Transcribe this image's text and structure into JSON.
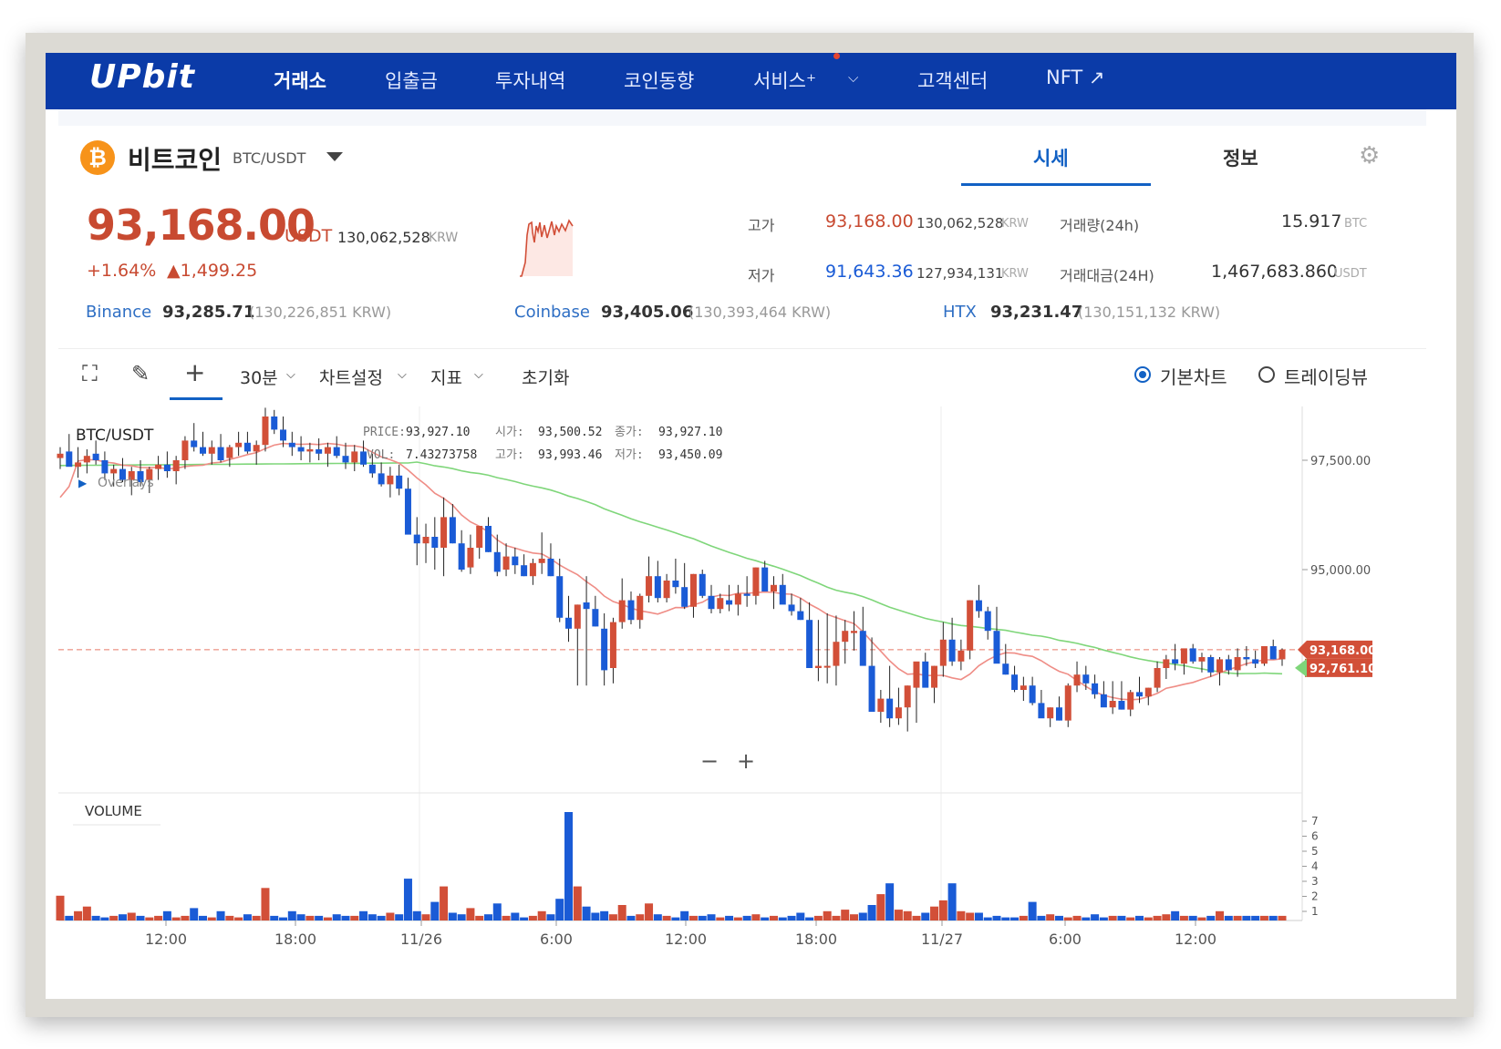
{
  "nav": {
    "logo": "UPbit",
    "items": [
      {
        "label": "거래소",
        "active": true
      },
      {
        "label": "입출금"
      },
      {
        "label": "투자내역"
      },
      {
        "label": "코인동향"
      },
      {
        "label": "서비스⁺"
      },
      {
        "label": "고객센터"
      },
      {
        "label": "NFT ↗"
      }
    ]
  },
  "header": {
    "coin_icon": "₿",
    "coin_name": "비트코인",
    "pair": "BTC/USDT",
    "tabs": [
      "시세",
      "정보"
    ],
    "settings_icon": "gear-icon"
  },
  "price": {
    "current": "93,168.00",
    "unit": "USDT",
    "krw": "130,062,528",
    "krw_unit": "KRW",
    "change_pct": "+1.64%",
    "change_abs": "▲1,499.25"
  },
  "stats": {
    "high_label": "고가",
    "high": "93,168.00",
    "high_krw": "130,062,528",
    "low_label": "저가",
    "low": "91,643.36",
    "low_krw": "127,934,131",
    "krw_unit": "KRW",
    "volume_label": "거래량(24h)",
    "volume": "15.917",
    "volume_unit": "BTC",
    "amount_label": "거래대금(24H)",
    "amount": "1,467,683.860",
    "amount_unit": "USDT"
  },
  "exchanges": [
    {
      "name": "Binance",
      "price": "93,285.71",
      "krw": "(130,226,851 KRW)"
    },
    {
      "name": "Coinbase",
      "price": "93,405.06",
      "krw": "(130,393,464 KRW)"
    },
    {
      "name": "HTX",
      "price": "93,231.47",
      "krw": "(130,151,132 KRW)"
    }
  ],
  "toolbar": {
    "interval": "30분",
    "chart_settings": "차트설정",
    "indicators": "지표",
    "reset": "초기화",
    "view_basic": "기본차트",
    "view_tradingview": "트레이딩뷰"
  },
  "ohlc": {
    "symbol": "BTC/USDT",
    "overlays": "Overlays",
    "price_label": "PRICE:",
    "price": "93,927.10",
    "vol_label": "VOL:",
    "vol": "7.43273758",
    "open_label": "시가:",
    "open": "93,500.52",
    "close_label": "종가:",
    "close": "93,927.10",
    "high_label": "고가:",
    "high": "93,993.46",
    "low_label": "저가:",
    "low": "93,450.09"
  },
  "chart_data": {
    "type": "candlestick",
    "interval_minutes": 30,
    "y_ticks": [
      "97,500.00",
      "95,000.00"
    ],
    "x_ticks": [
      "12:00",
      "18:00",
      "11/26",
      "6:00",
      "12:00",
      "18:00",
      "11/27",
      "6:00",
      "12:00"
    ],
    "ylim": [
      91200,
      98700
    ],
    "last_price_label": "93,168.00",
    "ma_label": "92,761.10",
    "volume_label": "VOLUME",
    "volume_ticks": [
      "7",
      "6",
      "5",
      "4",
      "3",
      "2",
      "1"
    ],
    "volume_ylim": [
      0,
      7.5
    ],
    "zoom_out": "−",
    "zoom_in": "+",
    "colors": {
      "up": "#d24f38",
      "down": "#1a5bd6",
      "ma_short": "#ef8d86",
      "ma_long": "#7fd67a"
    }
  }
}
